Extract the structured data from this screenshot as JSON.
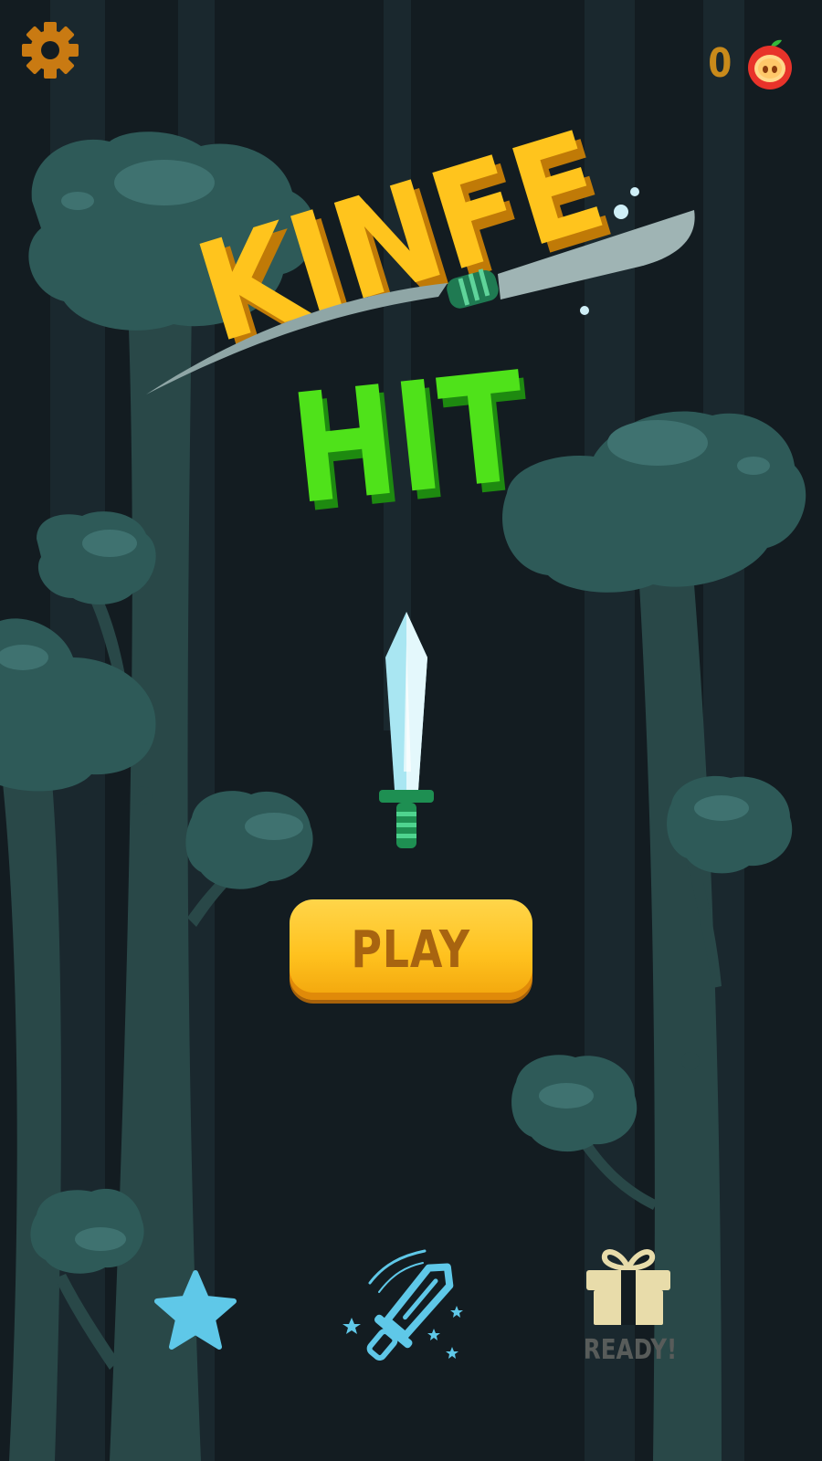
{
  "header": {
    "settings_icon": "gear-icon",
    "apple_count": "0",
    "apple_icon": "apple-icon"
  },
  "title": {
    "line1": "KINFE",
    "line2": "HIT"
  },
  "main": {
    "selected_knife_icon": "sword-icon",
    "play_label": "PLAY"
  },
  "bottom_bar": {
    "star_icon": "star-icon",
    "knives_icon": "sword-icon",
    "gift_icon": "gift-icon",
    "gift_label": "READY!"
  },
  "colors": {
    "background": "#131c21",
    "foliage": "#2e5a58",
    "title_gold": "#ffc41d",
    "title_green": "#4fe21a",
    "play_button": "#ffc21f",
    "play_text": "#a86410",
    "accent_blue": "#5fc8e8",
    "gift": "#e8dcaa",
    "counter": "#c98a1a"
  }
}
